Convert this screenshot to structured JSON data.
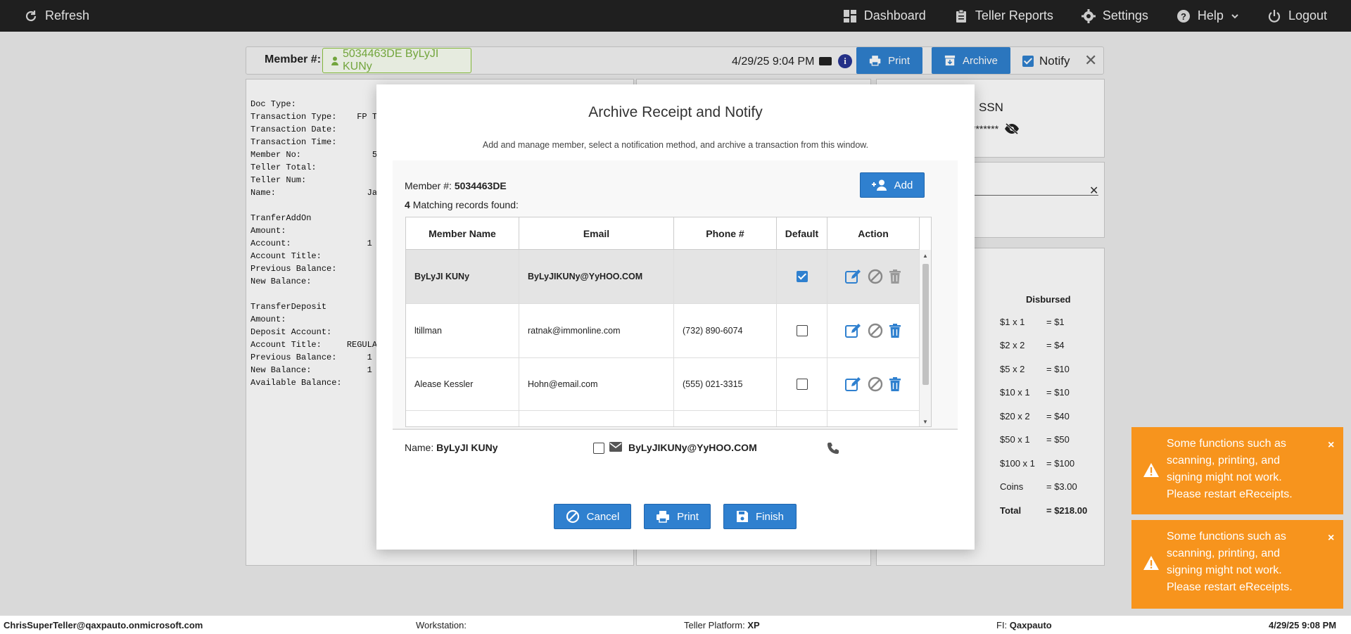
{
  "topbar": {
    "refresh": "Refresh",
    "dashboard": "Dashboard",
    "teller_reports": "Teller Reports",
    "settings": "Settings",
    "help": "Help",
    "logout": "Logout"
  },
  "member_bar": {
    "label": "Member #:",
    "member": "5034463DE ByLyJI KUNy",
    "datetime": "4/29/25 9:04 PM",
    "print": "Print",
    "archive": "Archive",
    "notify": "Notify"
  },
  "receipt": {
    "text": "Doc Type:\nTransaction Type:    FP TRA\nTransaction Date:\nTransaction Time:\nMember No:              5\nTeller Total:\nTeller Num:\nName:                  Ja\n\nTranferAddOn\nAmount:\nAccount:               1\nAccount Title:\nPrevious Balance:\nNew Balance:\n\nTransferDeposit\nAmount:\nDeposit Account:\nAccount Title:     REGULAR\nPrevious Balance:      1\nNew Balance:           1\nAvailable Balance:"
  },
  "ssn": {
    "label": "SSN",
    "mask": "*******"
  },
  "disbursed": {
    "header": "Disbursed",
    "rows": [
      {
        "d": "$1 x 1",
        "v": "= $1"
      },
      {
        "d": "$2 x 2",
        "v": "= $4"
      },
      {
        "d": "$5 x 2",
        "v": "= $10"
      },
      {
        "d": "$10 x 1",
        "v": "= $10"
      },
      {
        "d": "$20 x 2",
        "v": "= $40"
      },
      {
        "d": "$50 x 1",
        "v": "= $50"
      },
      {
        "d": "$100 x 1",
        "v": "= $100"
      },
      {
        "d": "Coins",
        "v": "= $3.00"
      },
      {
        "d": "Total",
        "v": "= $218.00"
      }
    ]
  },
  "modal": {
    "title": "Archive Receipt and Notify",
    "subtitle": "Add and manage member, select a notification method, and archive a transaction from this window.",
    "member_label": "Member #:",
    "member_no": "5034463DE",
    "count": "4",
    "count_text": "Matching records found:",
    "add": "Add",
    "columns": [
      "Member Name",
      "Email",
      "Phone #",
      "Default",
      "Action"
    ],
    "rows": [
      {
        "name": "ByLyJI KUNy",
        "email": "ByLyJIKUNy@YyHOO.COM",
        "phone": "",
        "default": true
      },
      {
        "name": "ltillman",
        "email": "ratnak@immonline.com",
        "phone": "(732) 890-6074",
        "default": false
      },
      {
        "name": "Alease Kessler",
        "email": "Hohn@email.com",
        "phone": "(555) 021-3315",
        "default": false
      }
    ],
    "name_label": "Name:",
    "name_value": "ByLyJI KUNy",
    "email_value": "ByLyJIKUNy@YyHOO.COM",
    "cancel": "Cancel",
    "print": "Print",
    "finish": "Finish"
  },
  "toasts": {
    "msg1": "Some functions such as scanning, printing, and signing might not work. Please restart eReceipts.",
    "msg2": "Some functions such as scanning, printing, and signing might not work. Please restart eReceipts.",
    "close": "×"
  },
  "footer": {
    "user": "ChrisSuperTeller@qaxpauto.onmicrosoft.com",
    "workstation_label": "Workstation:",
    "platform_label": "Teller Platform:",
    "platform_value": "XP",
    "fi_label": "FI:",
    "fi_value": "Qaxpauto",
    "datetime": "4/29/25 9:08 PM"
  },
  "colors": {
    "primary": "#2f80cf",
    "toast": "#f7941d",
    "topbar": "#222222",
    "member_green": "#7cb342"
  }
}
